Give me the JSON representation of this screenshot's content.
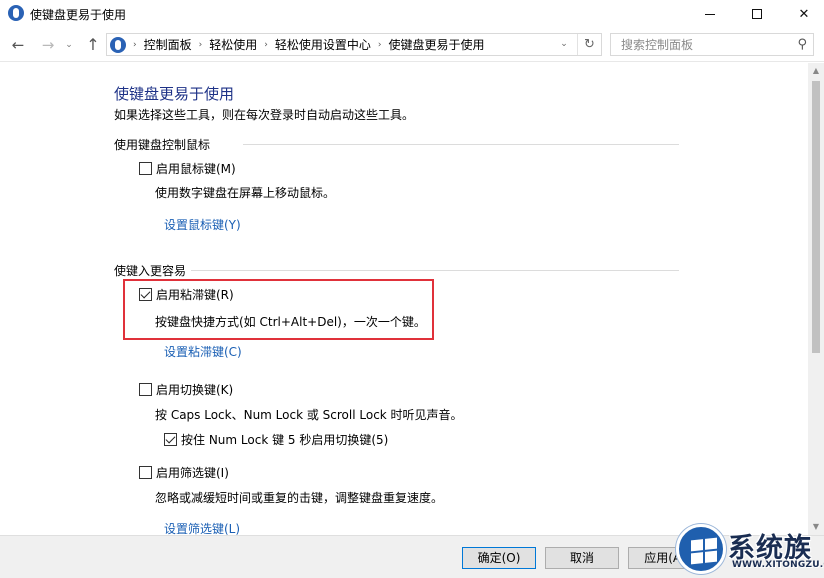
{
  "window": {
    "title": "使键盘更易于使用",
    "minimize_glyph": "",
    "maximize_glyph": "",
    "close_glyph": "✕"
  },
  "nav": {
    "back_glyph": "←",
    "forward_glyph": "→",
    "dropdown_glyph": "⌄",
    "up_glyph": "↑",
    "breadcrumb": [
      "控制面板",
      "轻松使用",
      "轻松使用设置中心",
      "使键盘更易于使用"
    ],
    "crumb_sep": "›",
    "addr_dropdown_glyph": "⌄",
    "refresh_glyph": "↻",
    "search_placeholder": "搜索控制面板",
    "search_glyph": "⚲"
  },
  "content": {
    "title": "使键盘更易于使用",
    "description": "如果选择这些工具，则在每次登录时自动启动这些工具。",
    "mouse_section": {
      "heading": "使用键盘控制鼠标",
      "mouse_keys": {
        "label": "启用鼠标键(M)",
        "checked": false,
        "description": "使用数字键盘在屏幕上移动鼠标。",
        "link": "设置鼠标键(Y)"
      }
    },
    "typing_section": {
      "heading": "使键入更容易",
      "sticky_keys": {
        "label": "启用粘滞键(R)",
        "checked": true,
        "description": "按键盘快捷方式(如 Ctrl+Alt+Del)，一次一个键。",
        "link": "设置粘滞键(C)"
      },
      "toggle_keys": {
        "label": "启用切换键(K)",
        "checked": false,
        "description": "按 Caps Lock、Num Lock 或 Scroll Lock 时听见声音。",
        "sub_option": {
          "label": "按住 Num Lock 键 5 秒启用切换键(5)",
          "checked": true
        }
      },
      "filter_keys": {
        "label": "启用筛选键(I)",
        "checked": false,
        "description": "忽略或减缓短时间或重复的击键，调整键盘重复速度。",
        "link": "设置筛选键(L)"
      }
    }
  },
  "scrollbar": {
    "up_glyph": "▲",
    "down_glyph": "▼"
  },
  "footer": {
    "ok": "确定(O)",
    "cancel": "取消",
    "apply": "应用(A)"
  },
  "watermark": {
    "name": "系统族",
    "url": "WWW.XITONGZU.COM"
  },
  "colors": {
    "title_blue": "#1e3287",
    "link_blue": "#1a5fb4",
    "highlight_red": "#e0313a",
    "footer_bg": "#f0f0f0"
  }
}
